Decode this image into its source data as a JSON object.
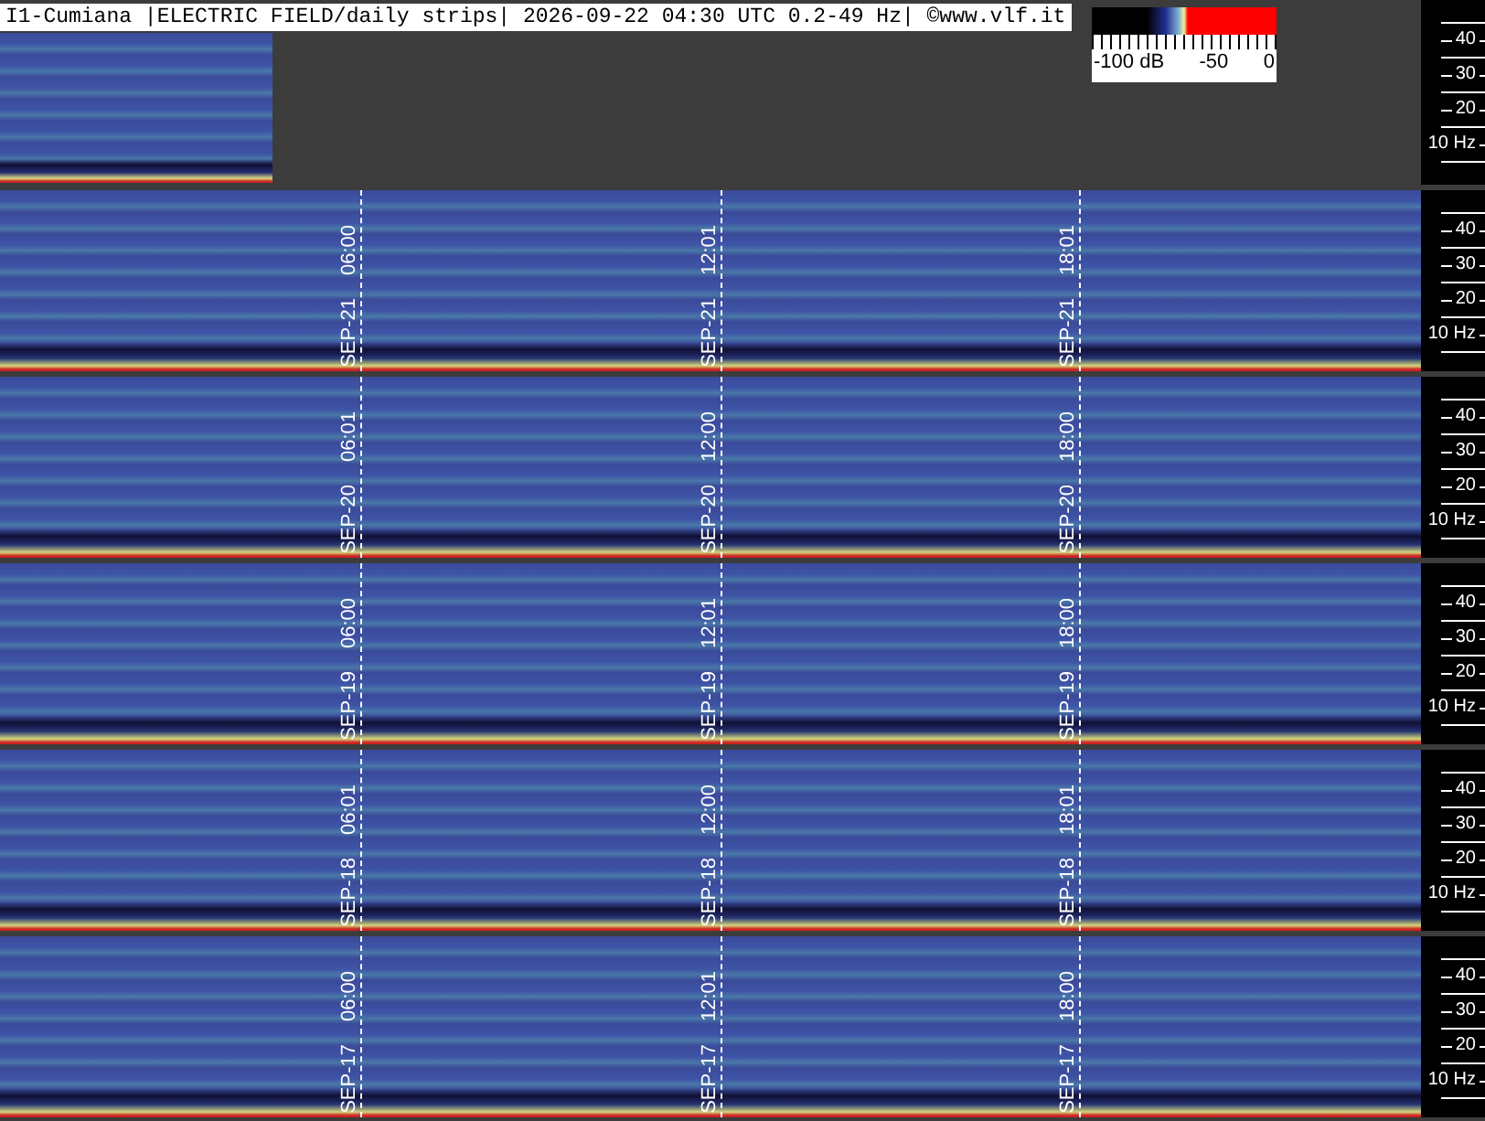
{
  "header": {
    "title": "I1-Cumiana |ELECTRIC FIELD/daily strips| 2026-09-22 04:30 UTC 0.2-49 Hz| ©www.vlf.it",
    "color_scale": {
      "labels": [
        "-100 dB",
        "-50",
        "0"
      ]
    },
    "axis_labels": [
      "40",
      "30",
      "20",
      "10 Hz"
    ]
  },
  "strips": [
    {
      "markers": [
        {
          "date": "SEP-21",
          "time": "06:00"
        },
        {
          "date": "SEP-21",
          "time": "12:01"
        },
        {
          "date": "SEP-21",
          "time": "18:01"
        }
      ],
      "axis_labels": [
        "40",
        "30",
        "20",
        "10 Hz"
      ]
    },
    {
      "markers": [
        {
          "date": "SEP-20",
          "time": "06:01"
        },
        {
          "date": "SEP-20",
          "time": "12:00"
        },
        {
          "date": "SEP-20",
          "time": "18:00"
        }
      ],
      "axis_labels": [
        "40",
        "30",
        "20",
        "10 Hz"
      ]
    },
    {
      "markers": [
        {
          "date": "SEP-19",
          "time": "06:00"
        },
        {
          "date": "SEP-19",
          "time": "12:01"
        },
        {
          "date": "SEP-19",
          "time": "18:00"
        }
      ],
      "axis_labels": [
        "40",
        "30",
        "20",
        "10 Hz"
      ]
    },
    {
      "markers": [
        {
          "date": "SEP-18",
          "time": "06:01"
        },
        {
          "date": "SEP-18",
          "time": "12:00"
        },
        {
          "date": "SEP-18",
          "time": "18:01"
        }
      ],
      "axis_labels": [
        "40",
        "30",
        "20",
        "10 Hz"
      ]
    },
    {
      "markers": [
        {
          "date": "SEP-17",
          "time": "06:00"
        },
        {
          "date": "SEP-17",
          "time": "12:01"
        },
        {
          "date": "SEP-17",
          "time": "18:00"
        }
      ],
      "axis_labels": [
        "40",
        "30",
        "20",
        "10 Hz"
      ]
    }
  ]
}
